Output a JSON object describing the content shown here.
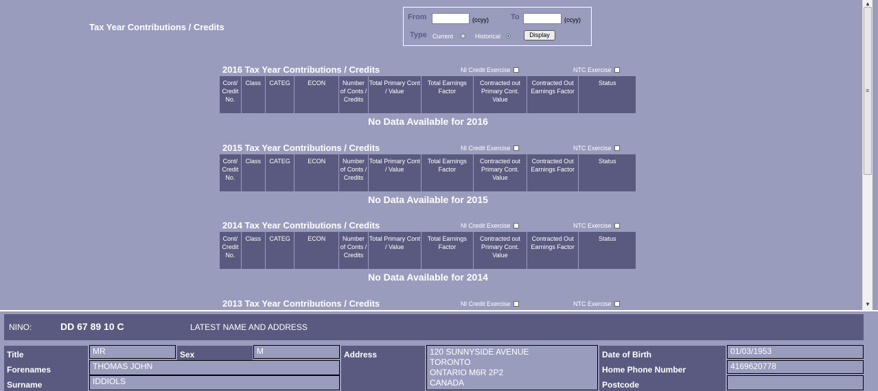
{
  "page": {
    "title": "Tax Year Contributions / Credits"
  },
  "filter": {
    "from_label": "From",
    "to_label": "To",
    "from_value": "",
    "to_value": "",
    "ccyy_hint": "(ccyy)",
    "type_label": "Type",
    "current_label": "Current",
    "historical_label": "Historical",
    "selected_type": "Historical",
    "display_button": "Display"
  },
  "table_columns": [
    "Cont/ Credit No.",
    "Class",
    "CATEG",
    "ECON",
    "Number of Conts / Credits",
    "Total Primary Cont / Value",
    "Total Earnings Factor",
    "Contracted out Primary Cont. Value",
    "Contracted Out Earnings Factor",
    "Status"
  ],
  "ni_credit_label": "NI Credit Exercise",
  "ntc_label": "NTC Exercise",
  "years": [
    {
      "title": "2016 Tax Year Contributions / Credits",
      "message": "No Data Available for 2016"
    },
    {
      "title": "2015 Tax Year Contributions / Credits",
      "message": "No Data Available for 2015"
    },
    {
      "title": "2014 Tax Year Contributions / Credits",
      "message": "No Data Available for 2014"
    },
    {
      "title": "2013 Tax Year Contributions / Credits",
      "message": ""
    }
  ],
  "person": {
    "nino_label": "NINO:",
    "nino_value": "DD 67 89 10 C",
    "latest_label": "LATEST NAME AND ADDRESS",
    "title_label": "Title",
    "title_value": "MR",
    "sex_label": "Sex",
    "sex_value": "M",
    "forenames_label": "Forenames",
    "forenames_value": "THOMAS JOHN",
    "surname_label": "Surname",
    "surname_value": "IDDIOLS",
    "address_label": "Address",
    "address_lines": [
      "120 SUNNYSIDE AVENUE",
      "TORONTO",
      "ONTARIO M6R 2P2",
      "CANADA"
    ],
    "dob_label": "Date of Birth",
    "dob_value": "01/03/1953",
    "phone_label": "Home Phone Number",
    "phone_value": "4169620778",
    "postcode_label": "Postcode",
    "postcode_value": ""
  },
  "colors": {
    "background": "#9a9cbd",
    "header": "#5a5a80",
    "label_blue": "#5a5a8a"
  }
}
